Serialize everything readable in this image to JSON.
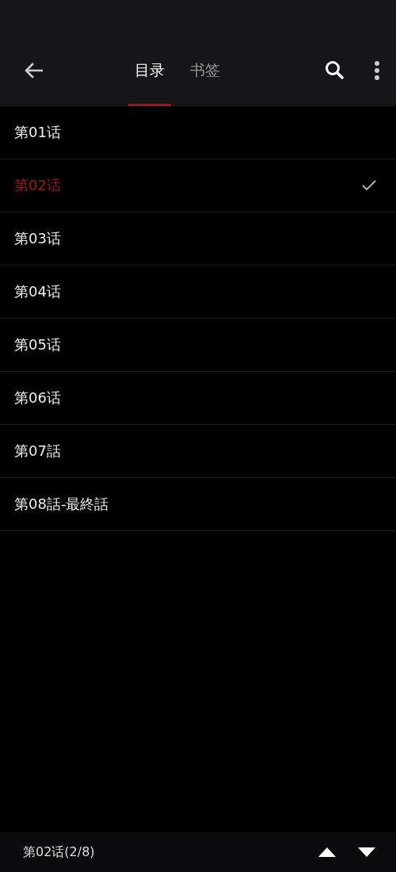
{
  "tabs": [
    {
      "label": "目录",
      "selected": true
    },
    {
      "label": "书签",
      "selected": false
    }
  ],
  "chapters": [
    {
      "title": "第01话",
      "selected": false
    },
    {
      "title": "第02话",
      "selected": true
    },
    {
      "title": "第03话",
      "selected": false
    },
    {
      "title": "第04话",
      "selected": false
    },
    {
      "title": "第05话",
      "selected": false
    },
    {
      "title": "第06话",
      "selected": false
    },
    {
      "title": "第07話",
      "selected": false
    },
    {
      "title": "第08話-最終話",
      "selected": false
    }
  ],
  "footer": {
    "position": "第02话(2/8)"
  }
}
